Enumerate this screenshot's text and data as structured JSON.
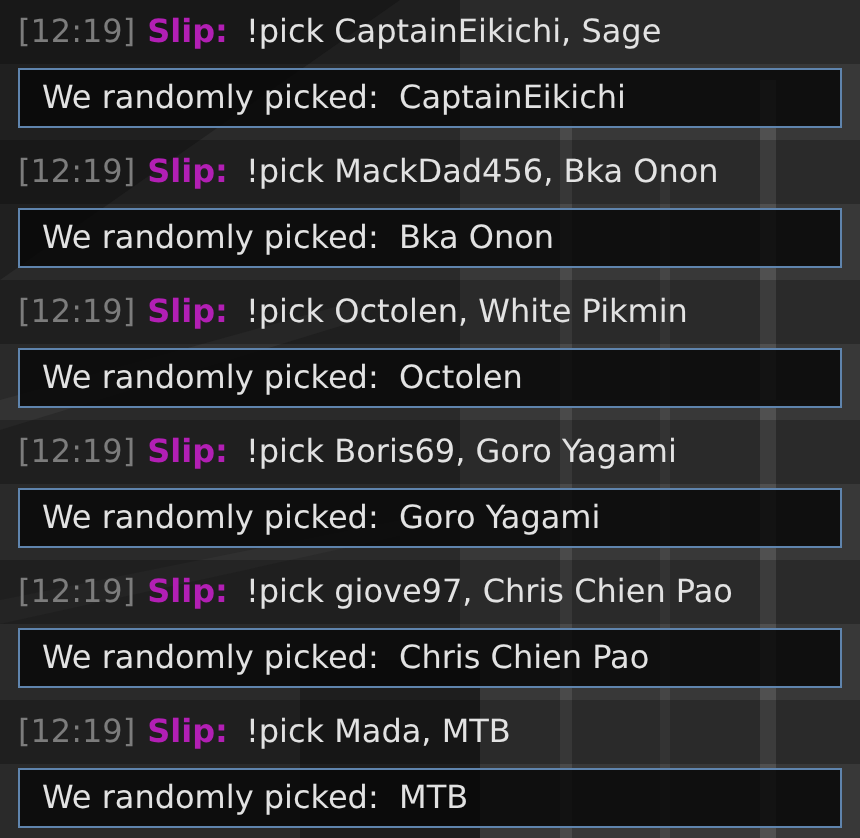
{
  "messages": [
    {
      "time": "[12:19]",
      "user": "Slip:",
      "text": "!pick CaptainEikichi, Sage",
      "reply": "We randomly picked:  CaptainEikichi"
    },
    {
      "time": "[12:19]",
      "user": "Slip:",
      "text": "!pick MackDad456, Bka Onon",
      "reply": "We randomly picked:  Bka Onon"
    },
    {
      "time": "[12:19]",
      "user": "Slip:",
      "text": "!pick Octolen, White Pikmin",
      "reply": "We randomly picked:  Octolen"
    },
    {
      "time": "[12:19]",
      "user": "Slip:",
      "text": "!pick Boris69, Goro Yagami",
      "reply": "We randomly picked:  Goro Yagami"
    },
    {
      "time": "[12:19]",
      "user": "Slip:",
      "text": "!pick giove97, Chris Chien Pao",
      "reply": "We randomly picked:  Chris Chien Pao"
    },
    {
      "time": "[12:19]",
      "user": "Slip:",
      "text": "!pick Mada, MTB",
      "reply": "We randomly picked:  MTB"
    }
  ]
}
